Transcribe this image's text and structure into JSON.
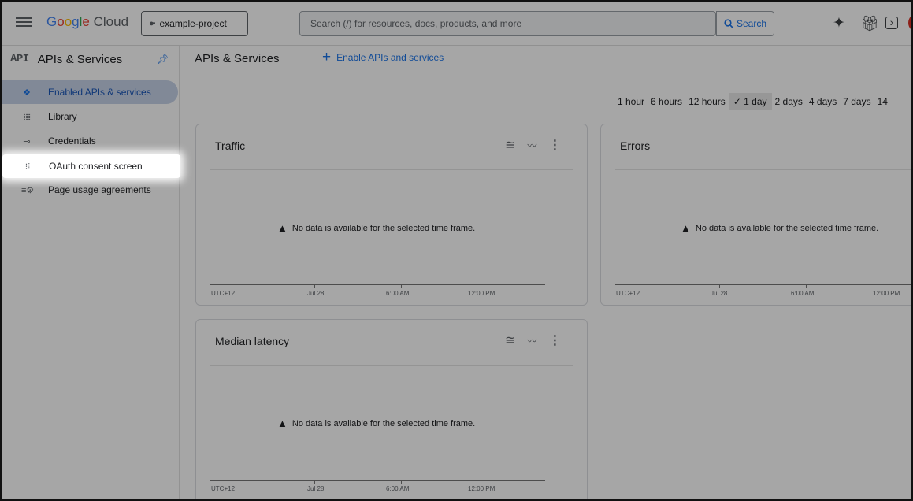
{
  "topbar": {
    "logo_google": "Google",
    "logo_cloud": "Cloud",
    "project": "example-project",
    "search_placeholder": "Search (/) for resources, docs, products, and more",
    "search_button": "Search"
  },
  "sidebar": {
    "logo": "API",
    "title": "APIs & Services",
    "items": [
      {
        "label": "Enabled APIs & services",
        "icon": "diamond-network-icon",
        "active": true
      },
      {
        "label": "Library",
        "icon": "library-icon"
      },
      {
        "label": "Credentials",
        "icon": "key-icon"
      },
      {
        "label": "OAuth consent screen",
        "icon": "consent-icon"
      },
      {
        "label": "Page usage agreements",
        "icon": "settings-list-icon"
      }
    ]
  },
  "main": {
    "title": "APIs & Services",
    "enable_label": "Enable APIs and services",
    "time_ranges": [
      "1 hour",
      "6 hours",
      "12 hours",
      "1 day",
      "2 days",
      "4 days",
      "7 days",
      "14"
    ],
    "selected_range": "1 day",
    "selected_check": "✓",
    "cards": [
      {
        "title": "Traffic",
        "no_data": "No data is available for the selected time frame.",
        "ticks": [
          "UTC+12",
          "Jul 28",
          "6:00 AM",
          "12:00 PM"
        ]
      },
      {
        "title": "Errors",
        "no_data": "No data is available for the selected time frame.",
        "ticks": [
          "UTC+12",
          "Jul 28",
          "6:00 AM",
          "12:00 PM"
        ]
      },
      {
        "title": "Median latency",
        "no_data": "No data is available for the selected time frame.",
        "ticks": [
          "UTC+12",
          "Jul 28",
          "6:00 AM",
          "12:00 PM"
        ]
      }
    ]
  },
  "colors": {
    "accent": "#1a73e8",
    "overlay": "rgba(0,0,0,0.35)"
  }
}
